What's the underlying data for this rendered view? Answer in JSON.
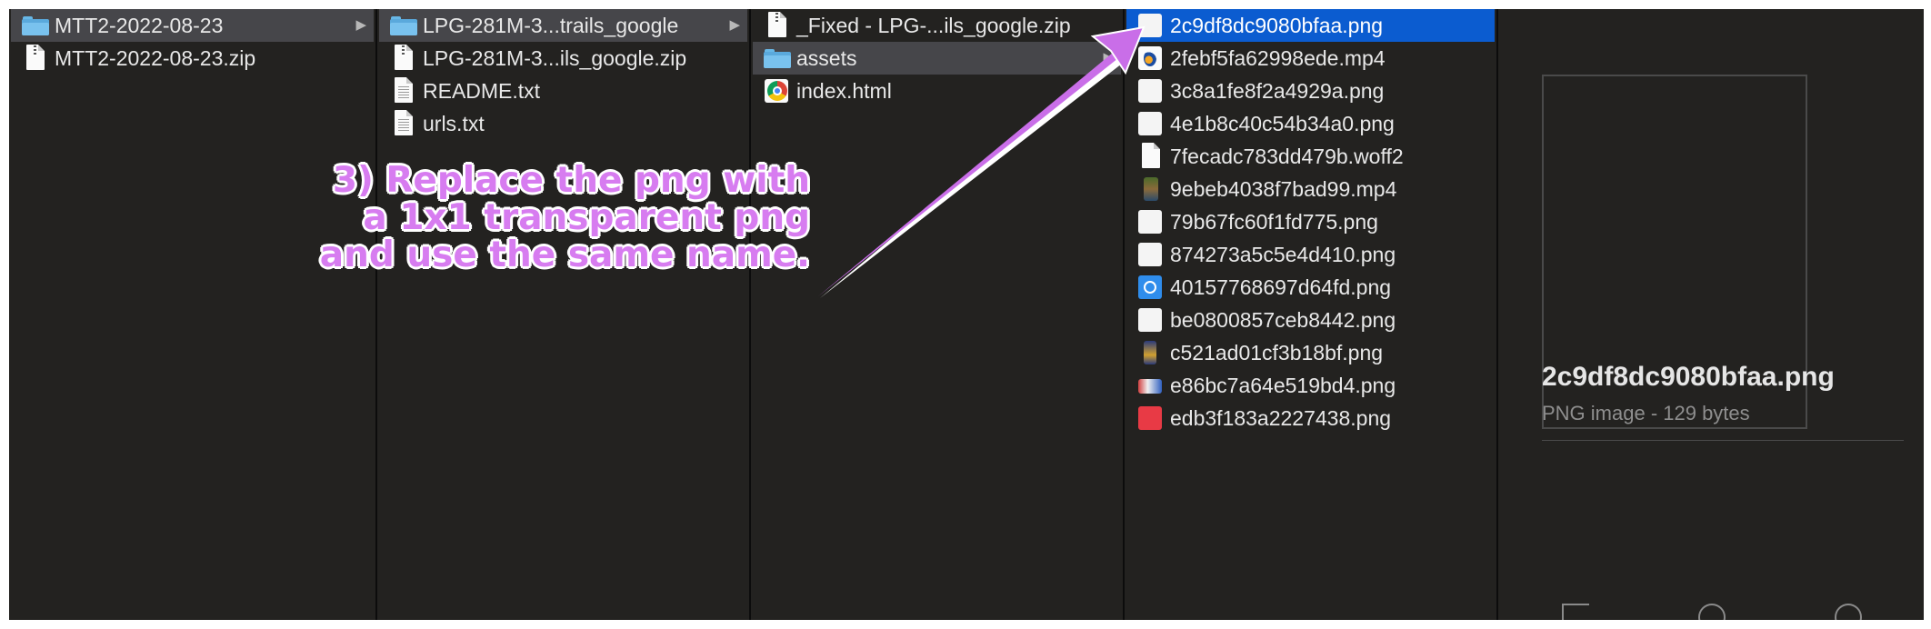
{
  "columns": {
    "col1": {
      "items": [
        {
          "label": "MTT2-2022-08-23",
          "icon": "folder-icon"
        },
        {
          "label": "MTT2-2022-08-23.zip",
          "icon": "zip-file-icon"
        }
      ]
    },
    "col2": {
      "items": [
        {
          "label": "LPG-281M-3...trails_google",
          "icon": "folder-icon"
        },
        {
          "label": "LPG-281M-3...ils_google.zip",
          "icon": "zip-file-icon"
        },
        {
          "label": "README.txt",
          "icon": "text-file-icon"
        },
        {
          "label": "urls.txt",
          "icon": "text-file-icon"
        }
      ]
    },
    "col3": {
      "items": [
        {
          "label": "_Fixed - LPG-...ils_google.zip",
          "icon": "zip-file-icon"
        },
        {
          "label": "assets",
          "icon": "folder-icon"
        },
        {
          "label": "index.html",
          "icon": "chrome-html-icon"
        }
      ]
    },
    "col4": {
      "items": [
        {
          "label": "2c9df8dc9080bfaa.png",
          "icon": "png-thumbnail-icon"
        },
        {
          "label": "2febf5fa62998ede.mp4",
          "icon": "video-file-icon"
        },
        {
          "label": "3c8a1fe8f2a4929a.png",
          "icon": "png-thumbnail-icon"
        },
        {
          "label": "4e1b8c40c54b34a0.png",
          "icon": "png-thumbnail-icon"
        },
        {
          "label": "7fecadc783dd479b.woff2",
          "icon": "blank-file-icon"
        },
        {
          "label": "9ebeb4038f7bad99.mp4",
          "icon": "video-thumbnail-icon"
        },
        {
          "label": "79b67fc60f1fd775.png",
          "icon": "png-thumbnail-icon"
        },
        {
          "label": "874273a5c5e4d410.png",
          "icon": "png-thumbnail-icon"
        },
        {
          "label": "40157768697d64fd.png",
          "icon": "app-store-icon"
        },
        {
          "label": "be0800857ceb8442.png",
          "icon": "png-thumbnail-icon"
        },
        {
          "label": "c521ad01cf3b18bf.png",
          "icon": "tall-image-thumbnail-icon"
        },
        {
          "label": "e86bc7a64e519bd4.png",
          "icon": "wide-image-thumbnail-icon"
        },
        {
          "label": "edb3f183a2227438.png",
          "icon": "red-square-thumbnail-icon"
        }
      ]
    }
  },
  "preview": {
    "filename": "2c9df8dc9080bfaa.png",
    "info": "PNG image - 129 bytes",
    "actions": [
      "rotate-icon",
      "markup-icon",
      "more-icon"
    ]
  },
  "annotation": {
    "line1": "3) Replace the png with",
    "line2": "a 1x1 transparent png",
    "line3": "and use the same name.",
    "color": "#d77cf0"
  },
  "colors": {
    "window_bg": "#232220",
    "selected_blue": "#0b5cd0",
    "path_gray": "#46464a"
  }
}
